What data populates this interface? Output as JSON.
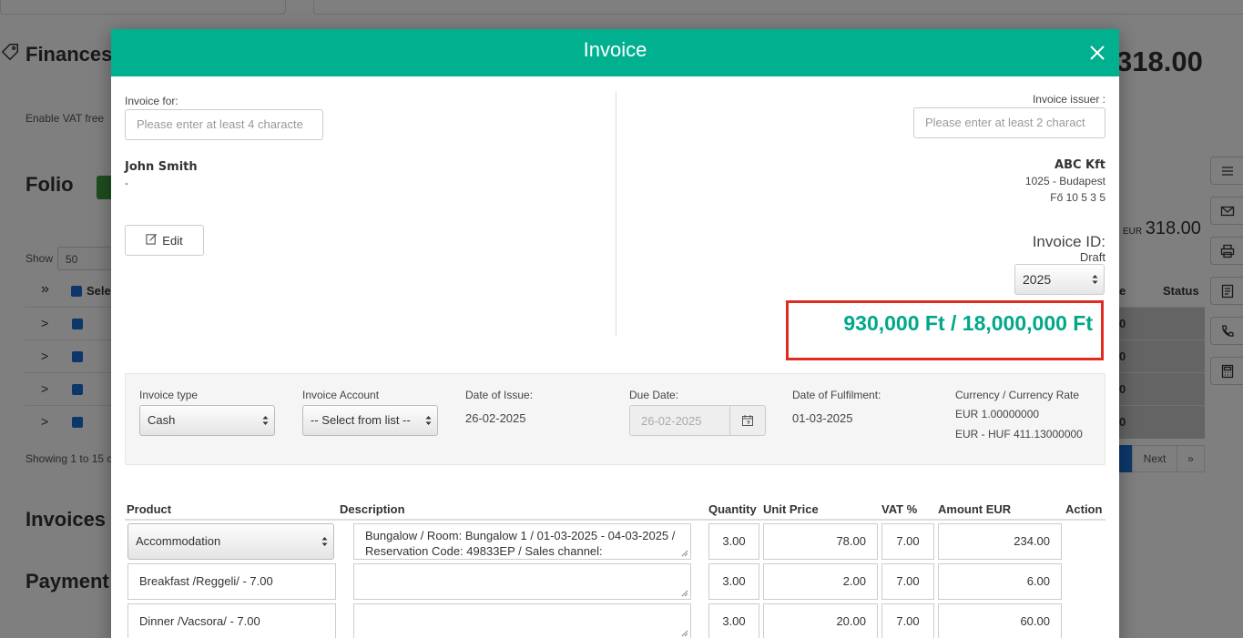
{
  "background": {
    "finances_title": "Finances",
    "total_amount": "318.00",
    "vat_free_label": "Enable VAT free",
    "folio_title": "Folio",
    "eur_currency": "EUR",
    "eur_amount": "318.00",
    "show_label": "Show",
    "show_value": "50",
    "col_select": "Sele",
    "col_e": "e",
    "col_status": "Status",
    "row_status": [
      "0",
      "0",
      "0",
      "0"
    ],
    "showing_text": "Showing 1 to 15 c",
    "pagination_next": "Next",
    "pagination_last": "»",
    "invoices_title": "Invoices",
    "payments_title": "Payment",
    "side_tools": [
      "list-icon",
      "mail-icon",
      "printer-icon",
      "document-icon",
      "phone-icon",
      "calculator-icon"
    ]
  },
  "modal": {
    "title": "Invoice",
    "invoice_for_label": "Invoice for:",
    "invoice_for_placeholder": "Please enter at least 4 characte",
    "customer_name": "John Smith",
    "customer_detail": "-",
    "edit_label": "Edit",
    "issuer_label": "Invoice issuer :",
    "issuer_placeholder": "Please enter at least 2 charact",
    "issuer_name": "ABC Kft",
    "issuer_city": "1025 - Budapest",
    "issuer_street": "Fő 10 5 3 5",
    "invoice_id_label": "Invoice ID:",
    "invoice_id_value": "Draft",
    "year_value": "2025",
    "balance_text": "930,000 Ft / 18,000,000 Ft",
    "colors": {
      "header": "#00b08f",
      "balance": "#00a889",
      "highlight": "#e02b20"
    }
  },
  "details": {
    "invoice_type_label": "Invoice type",
    "invoice_type_value": "Cash",
    "invoice_account_label": "Invoice Account",
    "invoice_account_value": "-- Select from list --",
    "date_issue_label": "Date of Issue:",
    "date_issue_value": "26-02-2025",
    "due_date_label": "Due Date:",
    "due_date_value": "26-02-2025",
    "fulfilment_label": "Date of Fulfilment:",
    "fulfilment_value": "01-03-2025",
    "currency_label": "Currency / Currency Rate",
    "currency_rate_1": "EUR 1.00000000",
    "currency_rate_2": "EUR - HUF 411.13000000"
  },
  "table": {
    "headers": {
      "product": "Product",
      "description": "Description",
      "quantity": "Quantity",
      "unit_price": "Unit Price",
      "vat": "VAT %",
      "amount": "Amount EUR",
      "action": "Action"
    },
    "rows": [
      {
        "product": "Accommodation",
        "description": "Bungalow  / Room: Bungalow 1  / 01-03-2025 - 04-03-2025 / Reservation Code: 49833EP / Sales channel:",
        "quantity": "3.00",
        "unit_price": "78.00",
        "vat": "7.00",
        "amount": "234.00"
      },
      {
        "product": "Breakfast /Reggeli/ - 7.00",
        "description": "",
        "quantity": "3.00",
        "unit_price": "2.00",
        "vat": "7.00",
        "amount": "6.00"
      },
      {
        "product": "Dinner /Vacsora/ - 7.00",
        "description": "",
        "quantity": "3.00",
        "unit_price": "20.00",
        "vat": "7.00",
        "amount": "60.00"
      }
    ]
  }
}
